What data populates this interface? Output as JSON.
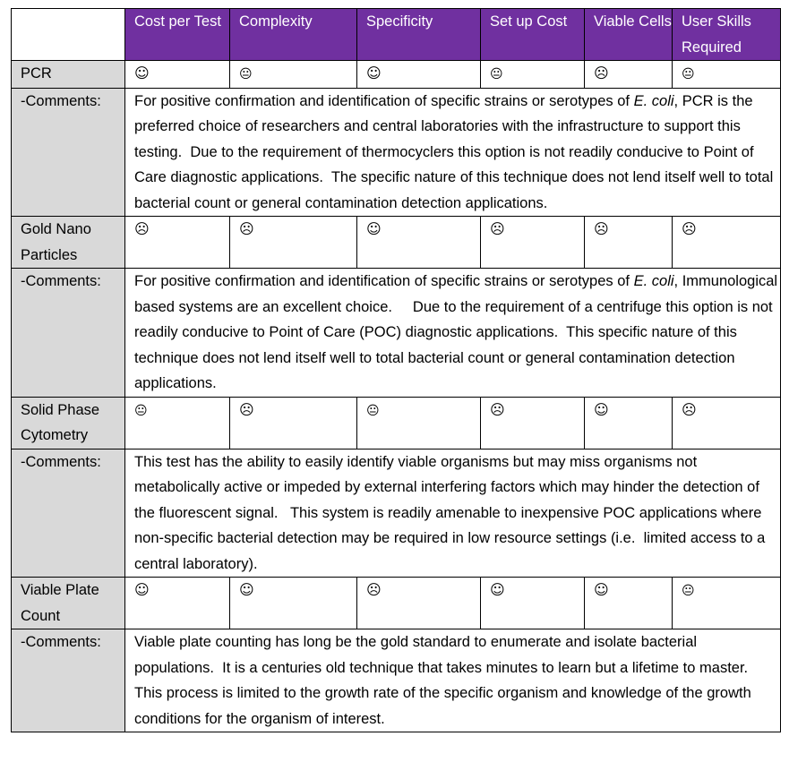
{
  "columns": [
    "Cost per Test",
    "Complexity",
    "Specificity",
    "Set up Cost",
    "Viable Cells",
    "User Skills Required"
  ],
  "rating_glyphs": {
    "good": "☺",
    "neutral": "😐",
    "bad": "☹"
  },
  "rows": [
    {
      "method": "PCR",
      "ratings": [
        "good",
        "neutral",
        "good",
        "neutral",
        "bad",
        "neutral"
      ],
      "comment_label": "-Comments:",
      "comment_pre": "For positive confirmation and identification of specific strains or serotypes of ",
      "comment_italic": "E. coli",
      "comment_post": ", PCR is the preferred choice of researchers and central laboratories with the infrastructure to support this testing.  Due to the requirement of thermocyclers this option is not readily conducive to Point of Care diagnostic applications.  The specific nature of this technique does not lend itself well to total bacterial count or general contamination detection applications."
    },
    {
      "method": "Gold Nano Particles",
      "ratings": [
        "bad",
        "bad",
        "good",
        "bad",
        "bad",
        "bad"
      ],
      "comment_label": "-Comments:",
      "comment_pre": "For positive confirmation and identification of specific strains or serotypes of ",
      "comment_italic": "E. coli",
      "comment_post": ", Immunological based systems are an excellent choice.     Due to the requirement of a centrifuge this option is not readily conducive to Point of Care (POC) diagnostic applications.  This specific nature of this technique does not lend itself well to total bacterial count or general contamination detection applications."
    },
    {
      "method": "Solid Phase Cytometry",
      "ratings": [
        "neutral",
        "bad",
        "neutral",
        "bad",
        "good",
        "bad"
      ],
      "comment_label": "-Comments:",
      "comment_pre": "This test has the ability to easily identify viable organisms but may miss organisms not metabolically active or impeded by external interfering factors which may hinder the detection of the fluorescent signal.   This system is readily amenable to inexpensive POC applications where non-specific bacterial detection may be required in low resource settings (i.e.  limited access to a central laboratory).",
      "comment_italic": "",
      "comment_post": ""
    },
    {
      "method": "Viable Plate Count",
      "ratings": [
        "good",
        "good",
        "bad",
        "good",
        "good",
        "neutral"
      ],
      "comment_label": "-Comments:",
      "comment_pre": "Viable plate counting has long be the gold standard to enumerate and isolate bacterial populations.  It is a centuries old technique that takes minutes to learn but a lifetime to master.  This process is limited to the growth rate of the specific organism and knowledge of the growth conditions for the organism of interest.",
      "comment_italic": "",
      "comment_post": ""
    }
  ]
}
